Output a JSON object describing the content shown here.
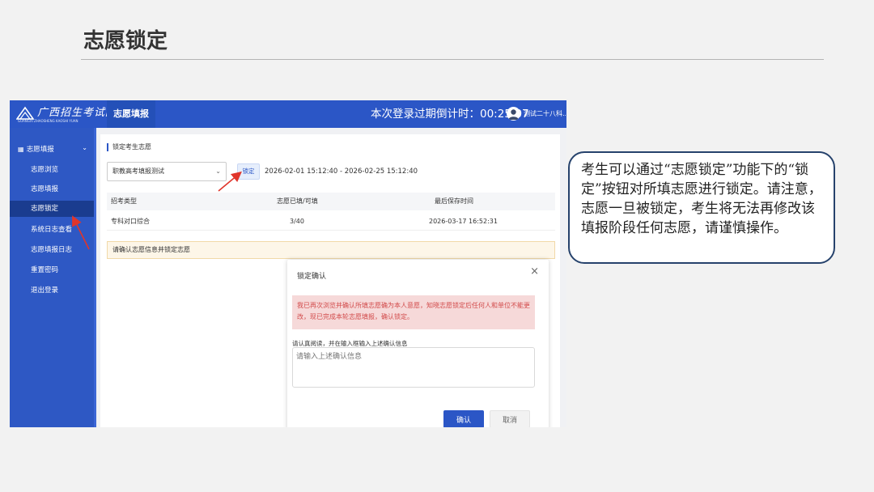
{
  "slide": {
    "title": "志愿锁定"
  },
  "app": {
    "logo_text": "广西招生考试院",
    "logo_sub": "GUANGXI ZHAOSHENG KAOSHI YUAN",
    "top_tab": "志愿填报",
    "countdown": "本次登录过期倒计时：00:25:07",
    "username": "测试二十八科..."
  },
  "sidebar": {
    "group": "志愿填报",
    "items": [
      {
        "label": "志愿浏览"
      },
      {
        "label": "志愿填报"
      },
      {
        "label": "志愿锁定"
      },
      {
        "label": "系统日志查看"
      },
      {
        "label": "志愿填报日志"
      },
      {
        "label": "重置密码"
      },
      {
        "label": "退出登录"
      }
    ],
    "active_index": 2
  },
  "panel": {
    "title": "锁定考生志愿",
    "select_value": "职教高考填报测试",
    "lock_label": "锁定",
    "date_range": "2026-02-01 15:12:40 - 2026-02-25 15:12:40",
    "table": {
      "headers": [
        "招考类型",
        "志愿已填/可填",
        "最后保存时间"
      ],
      "rows": [
        [
          "专科对口综合",
          "3/40",
          "2026-03-17 16:52:31"
        ]
      ]
    },
    "notice": "请确认志愿信息并锁定志愿"
  },
  "dialog": {
    "title": "锁定确认",
    "close": "×",
    "warning": "我已再次浏览并确认所填志愿确为本人意愿，知晓志愿锁定后任何人和单位不能更改，现已完成本轮志愿填报，确认锁定。",
    "label": "请认真阅读，并在输入框输入上述确认信息",
    "placeholder": "请输入上述确认信息",
    "ok": "确认",
    "cancel": "取消"
  },
  "callout": {
    "text": "考生可以通过“志愿锁定”功能下的“锁定”按钮对所填志愿进行锁定。请注意，志愿一旦被锁定，考生将无法再修改该填报阶段任何志愿，请谨慎操作。"
  },
  "colors": {
    "primary": "#2b56c6",
    "annotation_red": "#e0352b",
    "callout_border": "#26426c"
  }
}
